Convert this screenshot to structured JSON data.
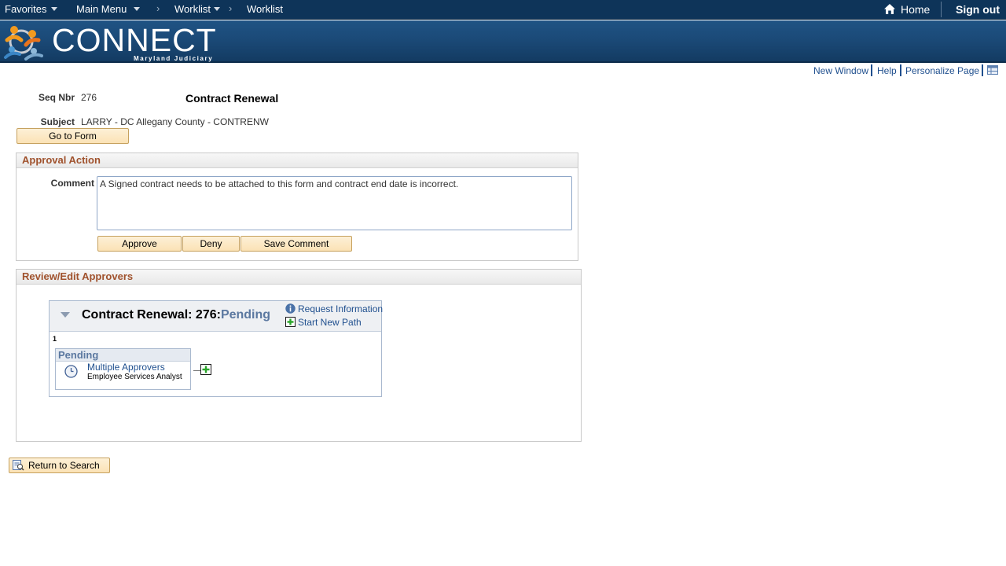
{
  "topnav": {
    "favorites": "Favorites",
    "main_menu": "Main Menu",
    "crumb1": "Worklist",
    "crumb2": "Worklist",
    "home": "Home",
    "sign_out": "Sign out"
  },
  "banner": {
    "logo_text": "CONNECT",
    "logo_sub": "Maryland Judiciary"
  },
  "page_links": {
    "new_window": "New Window",
    "help": "Help",
    "personalize": "Personalize Page"
  },
  "header": {
    "seq_label": "Seq Nbr",
    "seq_value": "276",
    "title": "Contract Renewal",
    "subject_label": "Subject",
    "subject_value": "LARRY - DC Allegany County - CONTRENW",
    "go_to_form": "Go to Form"
  },
  "approval_action": {
    "heading": "Approval Action",
    "comment_label": "Comment",
    "comment_value": "A Signed contract needs to be attached to this form and contract end date is incorrect.",
    "approve": "Approve",
    "deny": "Deny",
    "save_comment": "Save Comment"
  },
  "review": {
    "heading": "Review/Edit Approvers",
    "map_title": "Contract Renewal: 276:",
    "map_status": "Pending",
    "request_info": "Request Information",
    "start_new_path": "Start New Path",
    "step_number": "1",
    "step_status": "Pending",
    "approver": "Multiple Approvers",
    "approver_role": "Employee Services Analyst"
  },
  "footer": {
    "return_to_search": "Return to Search"
  },
  "colors": {
    "nav_bg": "#0e3459",
    "banner_bg": "#1b4a78",
    "link": "#1f4f8e",
    "section_heading": "#a0522d",
    "button_bg": "#fbe2b5"
  }
}
